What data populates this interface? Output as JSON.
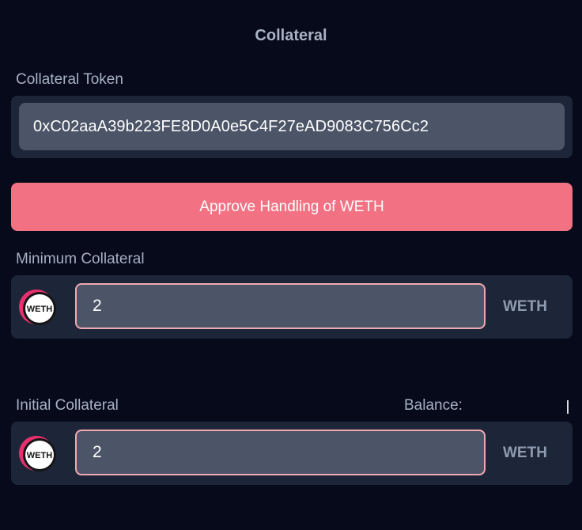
{
  "form": {
    "title": "Collateral",
    "collateral_token": {
      "label": "Collateral Token",
      "value": "0xC02aaA39b223FE8D0A0e5C4F27eAD9083C756Cc2"
    },
    "approve_button": {
      "label": "Approve Handling of WETH"
    },
    "minimum_collateral": {
      "label": "Minimum Collateral",
      "value": "2",
      "unit": "WETH",
      "token_icon": "weth-token-icon"
    },
    "initial_collateral": {
      "label": "Initial Collateral",
      "balance_label": "Balance:",
      "value": "2",
      "unit": "WETH",
      "token_icon": "weth-token-icon"
    }
  },
  "colors": {
    "background": "#060a1a",
    "panel": "#1d2638",
    "input": "#4b5567",
    "accent": "#f27283",
    "input_border": "#f0a9b1",
    "weth_pink": "#e8306e"
  }
}
